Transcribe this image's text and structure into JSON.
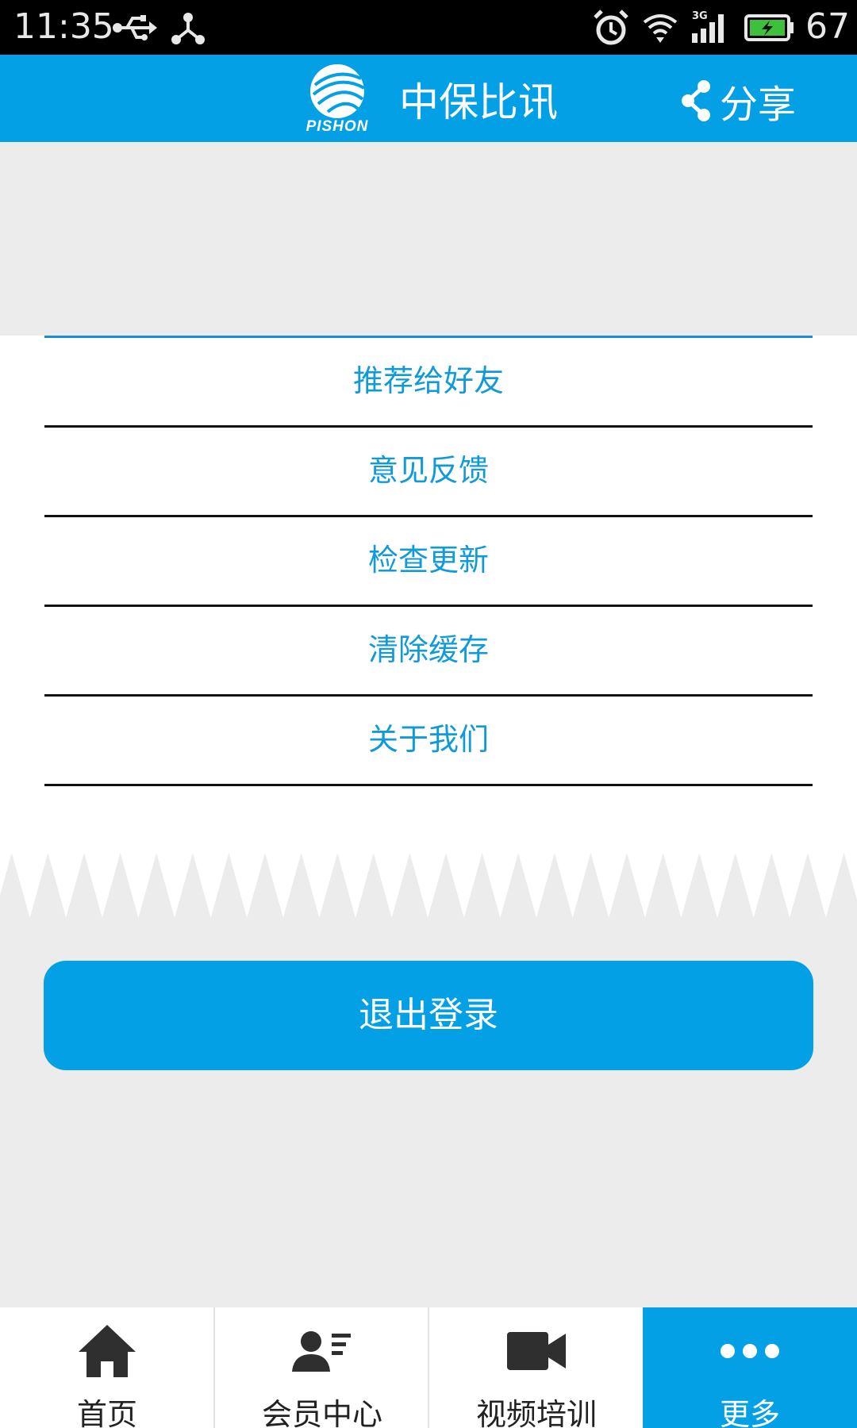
{
  "status_bar": {
    "time": "11:35",
    "battery_percent": "67",
    "network": "3G",
    "icons": [
      "usb-icon",
      "share-network-icon",
      "alarm-icon",
      "wifi-icon",
      "signal-icon",
      "battery-icon"
    ]
  },
  "header": {
    "logo_text": "PISHON",
    "title": "中保比讯",
    "share_label": "分享",
    "background_color": "#03a0e6"
  },
  "menu": {
    "items": [
      {
        "label": "推荐给好友"
      },
      {
        "label": "意见反馈"
      },
      {
        "label": "检查更新"
      },
      {
        "label": "清除缓存"
      },
      {
        "label": "关于我们"
      }
    ],
    "text_color": "#119ad8"
  },
  "logout_label": "退出登录",
  "bottom_nav": {
    "items": [
      {
        "label": "首页",
        "icon": "home-icon",
        "active": false
      },
      {
        "label": "会员中心",
        "icon": "member-icon",
        "active": false
      },
      {
        "label": "视频培训",
        "icon": "video-camera-icon",
        "active": false
      },
      {
        "label": "更多",
        "icon": "more-dots-icon",
        "active": true
      }
    ],
    "active_color": "#03a0e6"
  }
}
